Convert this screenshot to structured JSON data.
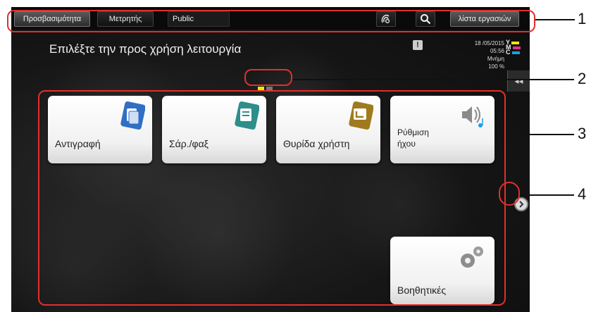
{
  "topbar": {
    "accessibility_label": "Προσβασιμότητα",
    "counter_label": "Μετρητής",
    "user_label": "Public",
    "job_list_label": "λίστα εργασιών",
    "icons": [
      "nfc-touch-icon",
      "search-icon"
    ]
  },
  "header": {
    "title": "Επιλέξτε την προς χρήση λειτουργία",
    "date": "18 /05/2015",
    "time": "05:56",
    "memory_label": "Μνήμη",
    "memory_value": "100 %",
    "toner": [
      {
        "label": "Y",
        "color": "#f5e400"
      },
      {
        "label": "M",
        "color": "#e0308c"
      },
      {
        "label": "C",
        "color": "#1aa0e0"
      }
    ]
  },
  "side_tab": {
    "glyph": "◂◂"
  },
  "tiles": [
    {
      "label": "Αντιγραφή",
      "icon": "copy-icon",
      "color": "#2f6fc4"
    },
    {
      "label": "Σάρ./φαξ",
      "icon": "scan-fax-icon",
      "color": "#2e8e8a"
    },
    {
      "label": "Θυρίδα χρήστη",
      "icon": "user-box-icon",
      "color": "#a07a1e"
    },
    {
      "label": "Ρύθμιση ήχου",
      "icon": "sound-icon",
      "color": "#666666"
    },
    {
      "label": "Βοηθητικές",
      "icon": "utility-gear-icon",
      "color": "#777777"
    }
  ],
  "callouts": [
    "1",
    "2",
    "3",
    "4"
  ],
  "colors": {
    "outline": "#e0302c",
    "accent_yellow": "#f5e400"
  }
}
